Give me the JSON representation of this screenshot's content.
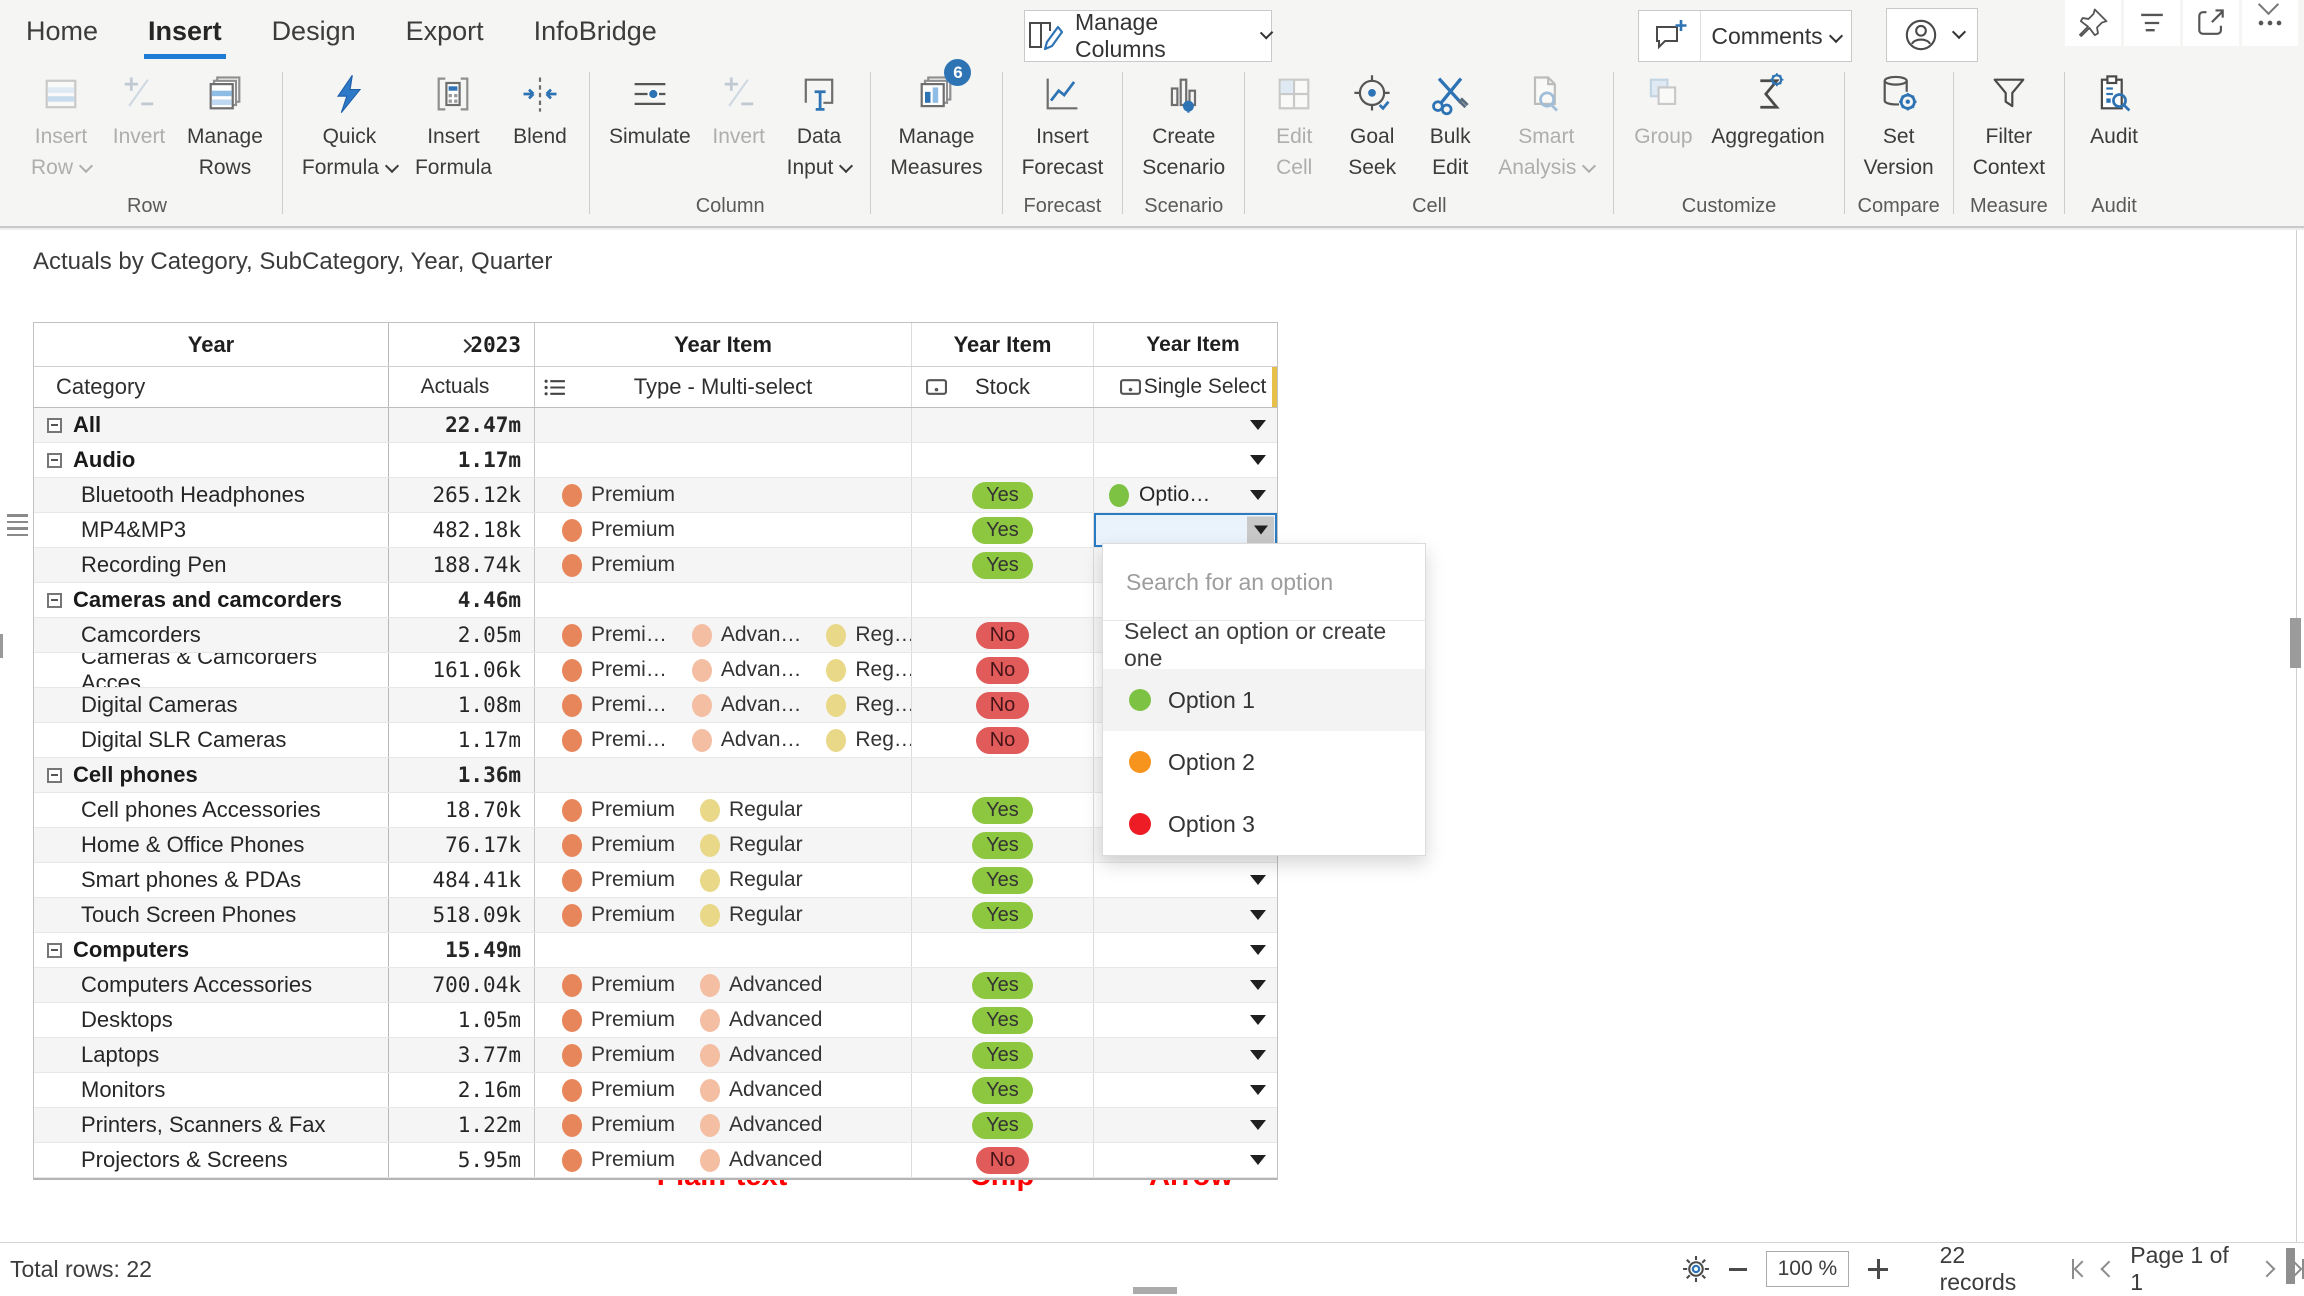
{
  "title": "Actuals by Category, SubCategory, Year, Quarter",
  "ribbon": {
    "tabs": [
      {
        "label": "Home",
        "active": false
      },
      {
        "label": "Insert",
        "active": true
      },
      {
        "label": "Design",
        "active": false
      },
      {
        "label": "Export",
        "active": false
      },
      {
        "label": "InfoBridge",
        "active": false
      }
    ],
    "manage_columns_label": "Manage Columns",
    "comments_label": "Comments",
    "segments": [
      {
        "label": "Row",
        "buttons": [
          {
            "top": "Insert",
            "bottom": "Row",
            "icon": "insert-row",
            "caret": true,
            "disabled": true
          },
          {
            "top": "Invert",
            "icon": "invert",
            "disabled": true
          },
          {
            "top": "Manage",
            "bottom": "Rows",
            "icon": "manage-rows"
          }
        ]
      },
      {
        "label": "",
        "buttons": [
          {
            "top": "Quick",
            "bottom": "Formula",
            "icon": "quick-formula",
            "caret": true
          },
          {
            "top": "Insert",
            "bottom": "Formula",
            "icon": "insert-formula"
          },
          {
            "top": "Blend",
            "icon": "blend"
          }
        ]
      },
      {
        "label": "Column",
        "buttons": [
          {
            "top": "Simulate",
            "icon": "simulate"
          },
          {
            "top": "Invert",
            "icon": "invert",
            "disabled": true
          },
          {
            "top": "Data",
            "bottom": "Input",
            "icon": "data-input",
            "caret": true
          }
        ]
      },
      {
        "label": "",
        "buttons": [
          {
            "top": "Manage",
            "bottom": "Measures",
            "icon": "manage-measures",
            "badge": "6"
          }
        ]
      },
      {
        "label": "Forecast",
        "buttons": [
          {
            "top": "Insert",
            "bottom": "Forecast",
            "icon": "insert-forecast"
          }
        ]
      },
      {
        "label": "Scenario",
        "buttons": [
          {
            "top": "Create",
            "bottom": "Scenario",
            "icon": "create-scenario"
          }
        ]
      },
      {
        "label": "Cell",
        "buttons": [
          {
            "top": "Edit",
            "bottom": "Cell",
            "icon": "edit-cell",
            "disabled": true
          },
          {
            "top": "Goal",
            "bottom": "Seek",
            "icon": "goal-seek"
          },
          {
            "top": "Bulk",
            "bottom": "Edit",
            "icon": "bulk-edit"
          },
          {
            "top": "Smart",
            "bottom": "Analysis",
            "icon": "smart-analysis",
            "caret": true,
            "disabled": true
          }
        ]
      },
      {
        "label": "Customize",
        "buttons": [
          {
            "top": "Group",
            "icon": "group",
            "disabled": true
          },
          {
            "top": "Aggregation",
            "icon": "aggregation"
          }
        ]
      },
      {
        "label": "Compare",
        "buttons": [
          {
            "top": "Set",
            "bottom": "Version",
            "icon": "set-version"
          }
        ]
      },
      {
        "label": "Measure",
        "buttons": [
          {
            "top": "Filter",
            "bottom": "Context",
            "icon": "filter-context"
          }
        ]
      },
      {
        "label": "Audit",
        "buttons": [
          {
            "top": "Audit",
            "icon": "audit"
          }
        ]
      }
    ]
  },
  "table": {
    "header1": [
      "Year",
      "2023",
      "Year Item",
      "Year Item",
      "Year Item"
    ],
    "header2": [
      "Category",
      "Actuals",
      "Type - Multi-select",
      "Stock",
      "Single Select"
    ],
    "type_colors": {
      "Premium": "#E8865B",
      "Premi…": "#E8865B",
      "Advanced": "#F4BEA3",
      "Advan…": "#F4BEA3",
      "Regular": "#E9D887",
      "Reg…": "#E9D887"
    },
    "rows": [
      {
        "name": "All",
        "level": 0,
        "value": "22.47m",
        "types": [],
        "stock": null
      },
      {
        "name": "Audio",
        "level": 0,
        "value": "1.17m",
        "types": [],
        "stock": null
      },
      {
        "name": "Bluetooth Headphones",
        "level": 1,
        "value": "265.12k",
        "types": [
          "Premium"
        ],
        "stock": "Yes",
        "single": "Optio…",
        "single_color": "#7DC243"
      },
      {
        "name": "MP4&MP3",
        "level": 1,
        "value": "482.18k",
        "types": [
          "Premium"
        ],
        "stock": "Yes",
        "selected": true
      },
      {
        "name": "Recording Pen",
        "level": 1,
        "value": "188.74k",
        "types": [
          "Premium"
        ],
        "stock": "Yes"
      },
      {
        "name": "Cameras and camcorders",
        "level": 0,
        "value": "4.46m",
        "types": [],
        "stock": null
      },
      {
        "name": "Camcorders",
        "level": 1,
        "value": "2.05m",
        "types": [
          "Premi…",
          "Advan…",
          "Reg…"
        ],
        "stock": "No"
      },
      {
        "name": "Cameras & Camcorders Acces…",
        "level": 1,
        "value": "161.06k",
        "types": [
          "Premi…",
          "Advan…",
          "Reg…"
        ],
        "stock": "No"
      },
      {
        "name": "Digital Cameras",
        "level": 1,
        "value": "1.08m",
        "types": [
          "Premi…",
          "Advan…",
          "Reg…"
        ],
        "stock": "No"
      },
      {
        "name": "Digital SLR Cameras",
        "level": 1,
        "value": "1.17m",
        "types": [
          "Premi…",
          "Advan…",
          "Reg…"
        ],
        "stock": "No"
      },
      {
        "name": "Cell phones",
        "level": 0,
        "value": "1.36m",
        "types": [],
        "stock": null
      },
      {
        "name": "Cell phones Accessories",
        "level": 1,
        "value": "18.70k",
        "types": [
          "Premium",
          "Regular"
        ],
        "stock": "Yes"
      },
      {
        "name": "Home & Office Phones",
        "level": 1,
        "value": "76.17k",
        "types": [
          "Premium",
          "Regular"
        ],
        "stock": "Yes"
      },
      {
        "name": "Smart phones & PDAs",
        "level": 1,
        "value": "484.41k",
        "types": [
          "Premium",
          "Regular"
        ],
        "stock": "Yes"
      },
      {
        "name": "Touch Screen Phones",
        "level": 1,
        "value": "518.09k",
        "types": [
          "Premium",
          "Regular"
        ],
        "stock": "Yes"
      },
      {
        "name": "Computers",
        "level": 0,
        "value": "15.49m",
        "types": [],
        "stock": null
      },
      {
        "name": "Computers Accessories",
        "level": 1,
        "value": "700.04k",
        "types": [
          "Premium",
          "Advanced"
        ],
        "stock": "Yes"
      },
      {
        "name": "Desktops",
        "level": 1,
        "value": "1.05m",
        "types": [
          "Premium",
          "Advanced"
        ],
        "stock": "Yes"
      },
      {
        "name": "Laptops",
        "level": 1,
        "value": "3.77m",
        "types": [
          "Premium",
          "Advanced"
        ],
        "stock": "Yes"
      },
      {
        "name": "Monitors",
        "level": 1,
        "value": "2.16m",
        "types": [
          "Premium",
          "Advanced"
        ],
        "stock": "Yes"
      },
      {
        "name": "Printers, Scanners & Fax",
        "level": 1,
        "value": "1.22m",
        "types": [
          "Premium",
          "Advanced"
        ],
        "stock": "Yes"
      },
      {
        "name": "Projectors & Screens",
        "level": 1,
        "value": "5.95m",
        "types": [
          "Premium",
          "Advanced"
        ],
        "stock": "No"
      }
    ]
  },
  "dropdown": {
    "placeholder": "Search for an option",
    "hint": "Select an option or create one",
    "options": [
      {
        "label": "Option 1",
        "color": "#7DC243",
        "highlight": true
      },
      {
        "label": "Option 2",
        "color": "#F7941D",
        "highlight": false
      },
      {
        "label": "Option 3",
        "color": "#EE1C25",
        "highlight": false
      }
    ]
  },
  "annotations": [
    "Plain-text",
    "Chip",
    "Arrow"
  ],
  "status": {
    "total": "Total rows: 22",
    "zoom": "100 %",
    "records": "22 records",
    "page": "Page 1 of 1"
  }
}
